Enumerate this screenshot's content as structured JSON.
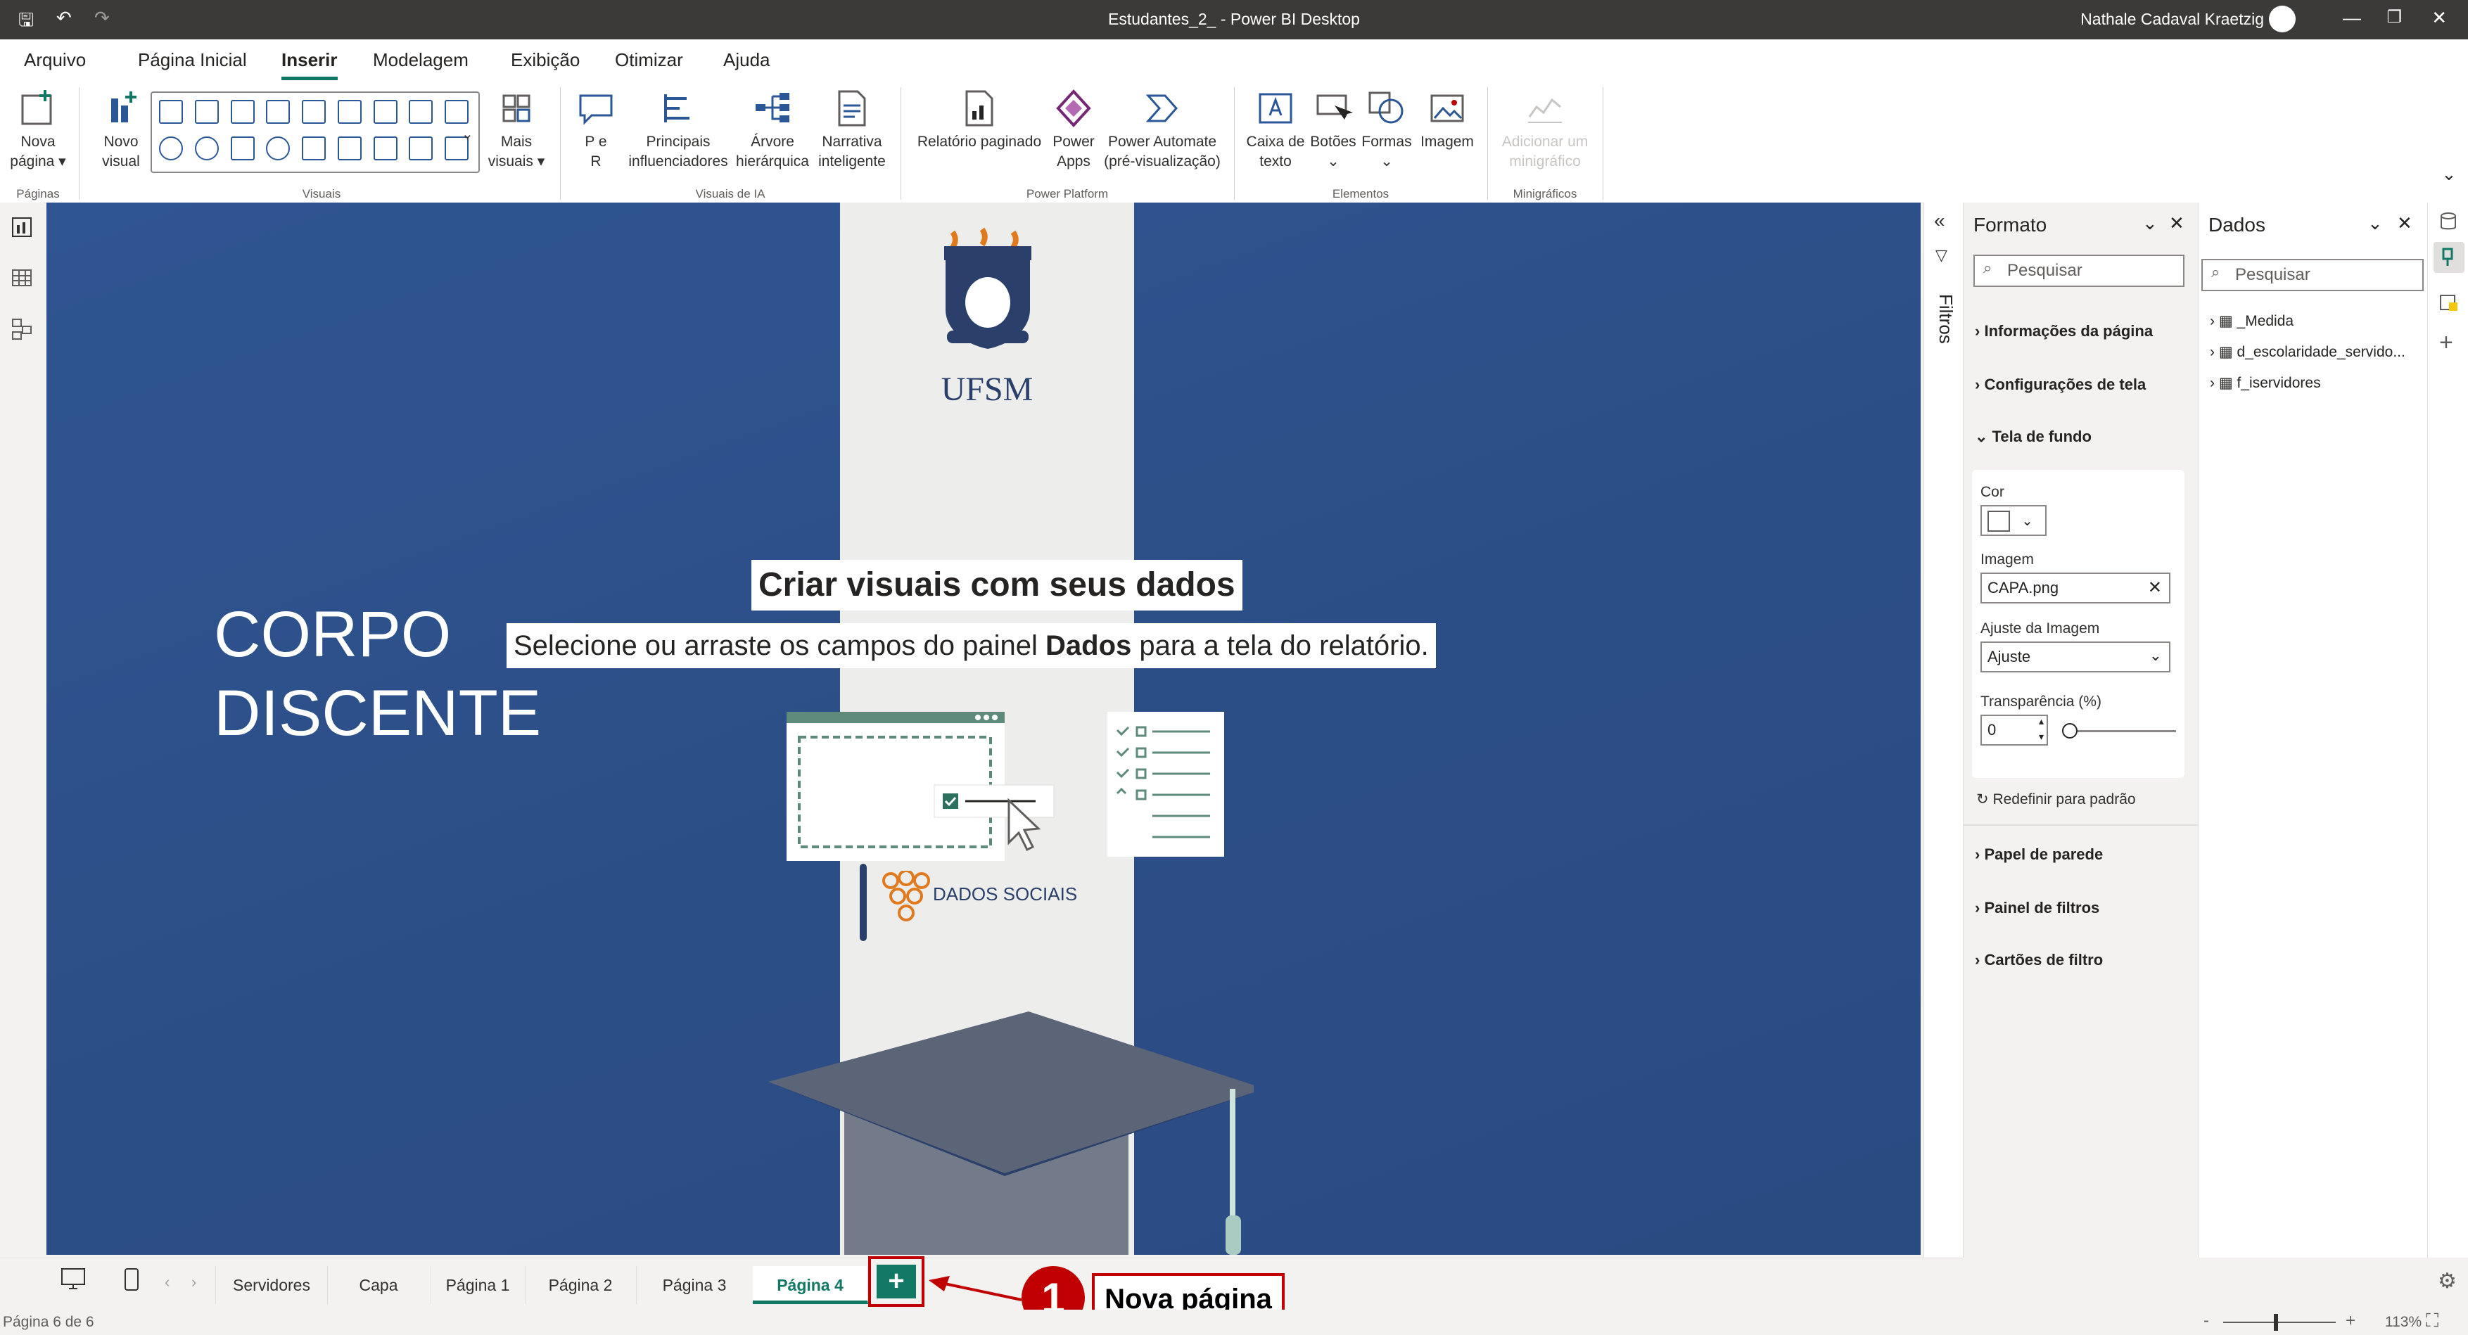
{
  "window": {
    "title": "Estudantes_2_ - Power BI Desktop",
    "user": "Nathale Cadaval Kraetzig"
  },
  "menu_tabs": [
    "Arquivo",
    "Página Inicial",
    "Inserir",
    "Modelagem",
    "Exibição",
    "Otimizar",
    "Ajuda"
  ],
  "active_tab": "Inserir",
  "ribbon": {
    "paginas": {
      "new_page_l1": "Nova",
      "new_page_l2": "página ▾",
      "group": "Páginas"
    },
    "visuais": {
      "new_visual_l1": "Novo",
      "new_visual_l2": "visual",
      "more_visuals_l1": "Mais",
      "more_visuals_l2": "visuais ▾",
      "group": "Visuais"
    },
    "ia": {
      "qa_l1": "P e",
      "qa_l2": "R",
      "key_l1": "Principais",
      "key_l2": "influenciadores",
      "tree_l1": "Árvore",
      "tree_l2": "hierárquica",
      "narr_l1": "Narrativa",
      "narr_l2": "inteligente",
      "group": "Visuais de IA"
    },
    "platform": {
      "paginated_l1": "Relatório paginado",
      "apps_l1": "Power",
      "apps_l2": "Apps",
      "automate_l1": "Power Automate",
      "automate_l2": "(pré-visualização)",
      "group": "Power Platform"
    },
    "elementos": {
      "textbox_l1": "Caixa de",
      "textbox_l2": "texto",
      "buttons_l1": "Botões",
      "buttons_l2": "⌄",
      "shapes_l1": "Formas",
      "shapes_l2": "⌄",
      "image_l1": "Imagem",
      "group": "Elementos"
    },
    "sparklines": {
      "add_l1": "Adicionar um",
      "add_l2": "minigráfico",
      "group": "Minigráficos"
    }
  },
  "canvas": {
    "logo_text": "UFSM",
    "heading_l1": "CORPO",
    "heading_l2": "DISCENTE",
    "popup_title": "Criar visuais com seus dados",
    "popup_sub_pre": "Selecione ou arraste os campos do painel ",
    "popup_sub_bold": "Dados",
    "popup_sub_post": " para a tela do relatório.",
    "brand": "DADOS SOCIAIS"
  },
  "filters_label": "Filtros",
  "format_pane": {
    "title": "Formato",
    "search_placeholder": "Pesquisar",
    "sections": [
      "Informações da página",
      "Configurações de tela",
      "Tela de fundo"
    ],
    "cor_label": "Cor",
    "image_label": "Imagem",
    "image_value": "CAPA.png",
    "fit_label": "Ajuste da Imagem",
    "fit_value": "Ajuste",
    "transparency_label": "Transparência (%)",
    "transparency_value": "0",
    "reset_label": "Redefinir para padrão",
    "more_sections": [
      "Papel de parede",
      "Painel de filtros",
      "Cartões de filtro"
    ]
  },
  "data_pane": {
    "title": "Dados",
    "search_placeholder": "Pesquisar",
    "tables": [
      "_Medida",
      "d_escolaridade_servido...",
      "f_iservidores"
    ]
  },
  "pages": [
    "Servidores",
    "Capa",
    "Página 1",
    "Página 2",
    "Página 3",
    "Página 4"
  ],
  "active_page": "Página 4",
  "new_page_symbol": "+",
  "callout": {
    "number": "1",
    "label": "Nova página"
  },
  "status": {
    "page_info": "Página 6 de 6",
    "zoom": "113%"
  },
  "colors": {
    "accent": "#117865",
    "canvas_bg": "#2c4e86",
    "callout": "#c00000"
  }
}
